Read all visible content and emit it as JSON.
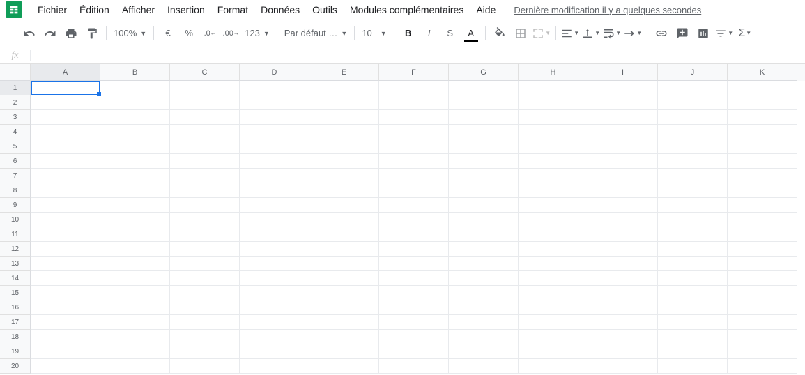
{
  "menu": {
    "items": [
      "Fichier",
      "Édition",
      "Afficher",
      "Insertion",
      "Format",
      "Données",
      "Outils",
      "Modules complémentaires",
      "Aide"
    ],
    "last_edit": "Dernière modification il y a quelques secondes"
  },
  "toolbar": {
    "zoom": "100%",
    "currency": "€",
    "percent": "%",
    "dec_less": ".0",
    "dec_more": ".00",
    "num_fmt": "123",
    "font": "Par défaut …",
    "font_size": "10"
  },
  "formula_bar": {
    "fx": "fx",
    "value": ""
  },
  "grid": {
    "columns": [
      "A",
      "B",
      "C",
      "D",
      "E",
      "F",
      "G",
      "H",
      "I",
      "J",
      "K"
    ],
    "rows": [
      1,
      2,
      3,
      4,
      5,
      6,
      7,
      8,
      9,
      10,
      11,
      12,
      13,
      14,
      15,
      16,
      17,
      18,
      19,
      20
    ],
    "active_cell": "A1",
    "selected_col": "A",
    "selected_row": 1
  }
}
